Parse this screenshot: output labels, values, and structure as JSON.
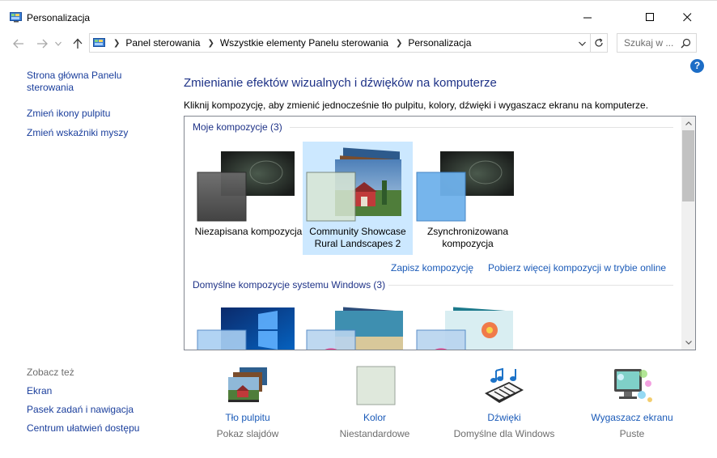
{
  "window": {
    "title": "Personalizacja",
    "icon": "control-panel-icon"
  },
  "address": {
    "crumbs": [
      "Panel sterowania",
      "Wszystkie elementy Panelu sterowania",
      "Personalizacja"
    ],
    "search_placeholder": "Szukaj w ..."
  },
  "help": {
    "label": "?"
  },
  "sidebar": {
    "links": [
      "Strona główna Panelu sterowania",
      "Zmień ikony pulpitu",
      "Zmień wskaźniki myszy"
    ],
    "see_also_title": "Zobacz też",
    "see_also": [
      "Ekran",
      "Pasek zadań i nawigacja",
      "Centrum ułatwień dostępu"
    ]
  },
  "main": {
    "title": "Zmienianie efektów wizualnych i dźwięków na komputerze",
    "description": "Kliknij kompozycję, aby zmienić jednocześnie tło pulpitu, kolory, dźwięki i wygaszacz ekranu na komputerze."
  },
  "themes": {
    "my_group": "Moje kompozycje (3)",
    "my_themes": [
      {
        "label": "Niezapisana kompozycja",
        "selected": false
      },
      {
        "label": "Community Showcase Rural Landscapes 2",
        "selected": true
      },
      {
        "label": "Zsynchronizowana kompozycja",
        "selected": false
      }
    ],
    "save_link": "Zapisz kompozycję",
    "more_link": "Pobierz więcej kompozycji w trybie online",
    "default_group": "Domyślne kompozycje systemu Windows (3)"
  },
  "bottom": [
    {
      "label": "Tło pulpitu",
      "sub": "Pokaz slajdów",
      "icon": "desktop-background-icon"
    },
    {
      "label": "Kolor",
      "sub": "Niestandardowe",
      "icon": "color-swatch-icon",
      "color": "#dfe8dc"
    },
    {
      "label": "Dźwięki",
      "sub": "Domyślne dla Windows",
      "icon": "sounds-icon"
    },
    {
      "label": "Wygaszacz ekranu",
      "sub": "Puste",
      "icon": "screensaver-icon"
    }
  ],
  "colors": {
    "link": "#1a5ab8",
    "title_blue": "#1e3287",
    "selection": "#cce8ff"
  }
}
